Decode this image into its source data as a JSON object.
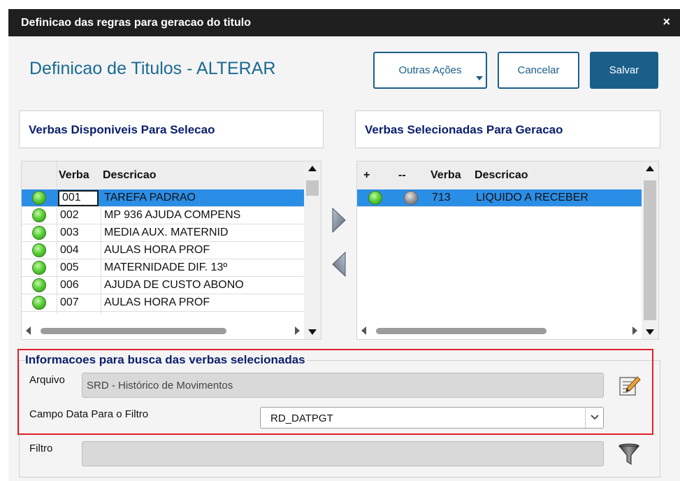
{
  "window": {
    "title": "Definicao das regras para geracao do titulo",
    "close_symbol": "×"
  },
  "header": {
    "title": "Definicao de Titulos - ALTERAR",
    "buttons": {
      "outras": "Outras Ações",
      "cancel": "Cancelar",
      "save": "Salvar"
    }
  },
  "left_panel": {
    "title": "Verbas Disponiveis Para Selecao",
    "columns": [
      "Verba",
      "Descricao"
    ],
    "rows": [
      {
        "verba": "001",
        "descricao": "TAREFA PADRAO",
        "status": "green",
        "selected": true
      },
      {
        "verba": "002",
        "descricao": "MP 936 AJUDA COMPENS",
        "status": "green"
      },
      {
        "verba": "003",
        "descricao": "MEDIA AUX. MATERNID",
        "status": "green"
      },
      {
        "verba": "004",
        "descricao": "AULAS HORA PROF",
        "status": "green"
      },
      {
        "verba": "005",
        "descricao": "MATERNIDADE DIF. 13º",
        "status": "green"
      },
      {
        "verba": "006",
        "descricao": "AJUDA DE CUSTO ABONO",
        "status": "green"
      },
      {
        "verba": "007",
        "descricao": "AULAS HORA PROF",
        "status": "green"
      }
    ]
  },
  "right_panel": {
    "title": "Verbas Selecionadas Para Geracao",
    "columns": [
      "+",
      "--",
      "Verba",
      "Descricao"
    ],
    "rows": [
      {
        "plus": "green",
        "minus": "gray",
        "verba": "713",
        "descricao": "LIQUIDO A RECEBER",
        "selected": true
      }
    ]
  },
  "info": {
    "title": "Informacoes para busca das verbas selecionadas",
    "arquivo": {
      "label": "Arquivo",
      "value": "SRD - Histórico de Movimentos"
    },
    "campo_data": {
      "label": "Campo Data Para o Filtro",
      "value": "RD_DATPGT"
    },
    "filtro": {
      "label": "Filtro",
      "value": ""
    }
  },
  "colors": {
    "accent": "#1a5f8a",
    "selection": "#2b8ee6",
    "highlight": "#e0202a",
    "heading": "#0b1f6e"
  }
}
